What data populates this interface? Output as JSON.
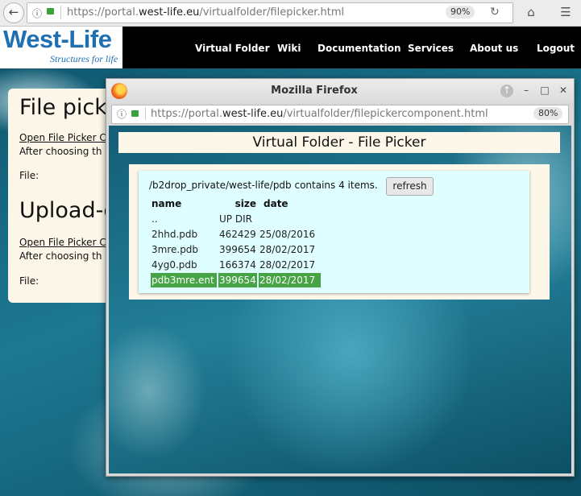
{
  "browser": {
    "url_prefix": "https://portal.",
    "url_domain": "west-life.eu",
    "url_path": "/virtualfolder/filepicker.html",
    "zoom": "90%"
  },
  "site": {
    "logo_main": "West-Life",
    "logo_sub": "Structures for life",
    "nav": [
      "Virtual Folder",
      "Wiki",
      "Documentation",
      "Services",
      "About us",
      "Logout"
    ]
  },
  "page": {
    "heading1": "File pick",
    "link1": "Open File Picker C",
    "text1": "After choosing th",
    "file1": "File:",
    "heading2": "Upload-c",
    "link2": "Open File Picker C",
    "text2": "After choosing th",
    "file2": "File:"
  },
  "popup": {
    "title": "Mozilla Firefox",
    "url_prefix": "https://portal.",
    "url_domain": "west-life.eu",
    "url_path": "/virtualfolder/filepickercomponent.html",
    "zoom": "80%",
    "header": "Virtual Folder - File Picker",
    "path_text": "/b2drop_private/west-life/pdb contains 4 items.",
    "refresh_label": "refresh",
    "columns": [
      "name",
      "size",
      "date"
    ],
    "rows": [
      {
        "name": "..",
        "size": "UP DIR",
        "date": ""
      },
      {
        "name": "2hhd.pdb",
        "size": "462429",
        "date": "25/08/2016"
      },
      {
        "name": "3mre.pdb",
        "size": "399654",
        "date": "28/02/2017"
      },
      {
        "name": "4yg0.pdb",
        "size": "166374",
        "date": "28/02/2017"
      },
      {
        "name": "pdb3mre.ent",
        "size": "399654",
        "date": "28/02/2017"
      }
    ]
  },
  "colors": {
    "selected_row": "#47a445",
    "panel_bg": "#fdf7e9",
    "list_bg": "#dffeff",
    "logo_blue": "#1f6fb3"
  }
}
